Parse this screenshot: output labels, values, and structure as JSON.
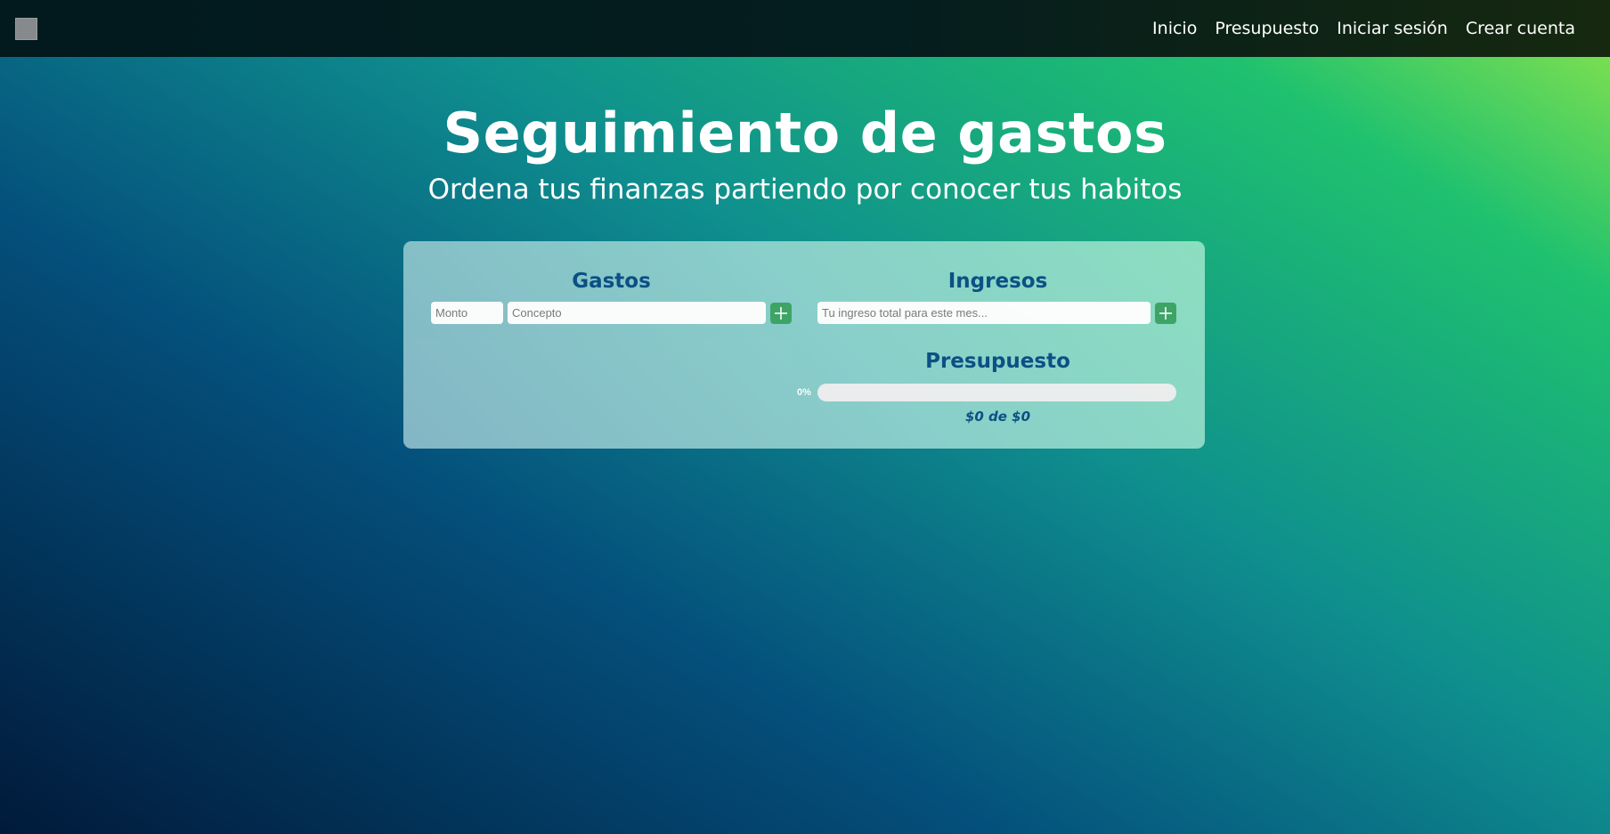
{
  "nav": {
    "logo_icon": "logo-placeholder-icon",
    "links": [
      {
        "label": "Inicio"
      },
      {
        "label": "Presupuesto"
      },
      {
        "label": "Iniciar sesión"
      },
      {
        "label": "Crear cuenta"
      }
    ]
  },
  "hero": {
    "title": "Seguimiento de gastos",
    "subtitle": "Ordena tus finanzas partiendo por conocer tus habitos"
  },
  "gastos": {
    "title": "Gastos",
    "monto_placeholder": "Monto",
    "concepto_placeholder": "Concepto",
    "add_icon": "plus-icon"
  },
  "ingresos": {
    "title": "Ingresos",
    "ingreso_placeholder": "Tu ingreso total para este mes...",
    "add_icon": "plus-icon"
  },
  "presupuesto": {
    "title": "Presupuesto",
    "progress_label": "0%",
    "progress_fraction": 0,
    "summary": "$0 de $0"
  },
  "colors": {
    "accent_green": "#3fa566",
    "heading_blue": "#0c4f84"
  }
}
